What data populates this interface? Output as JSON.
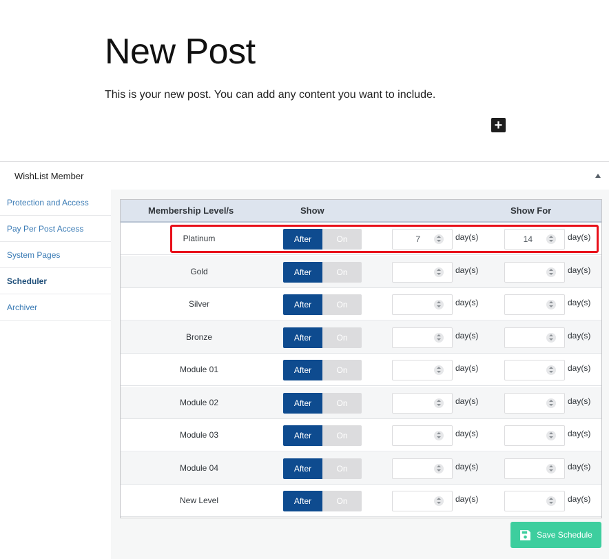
{
  "editor": {
    "title": "New Post",
    "body": "This is your new post. You can add any content you want to include.",
    "add_block_symbol": "+"
  },
  "metabox": {
    "title": "WishList Member"
  },
  "nav": [
    {
      "label": "Protection and Access",
      "active": false
    },
    {
      "label": "Pay Per Post Access",
      "active": false
    },
    {
      "label": "System Pages",
      "active": false
    },
    {
      "label": "Scheduler",
      "active": true
    },
    {
      "label": "Archiver",
      "active": false
    }
  ],
  "table": {
    "headers": {
      "level": "Membership Level/s",
      "show": "Show",
      "show_for": "Show For"
    },
    "toggle_labels": {
      "after": "After",
      "on": "On"
    },
    "unit": "day(s)",
    "rows": [
      {
        "level": "Platinum",
        "show_after": "7",
        "show_for": "14"
      },
      {
        "level": "Gold",
        "show_after": "",
        "show_for": ""
      },
      {
        "level": "Silver",
        "show_after": "",
        "show_for": ""
      },
      {
        "level": "Bronze",
        "show_after": "",
        "show_for": ""
      },
      {
        "level": "Module 01",
        "show_after": "",
        "show_for": ""
      },
      {
        "level": "Module 02",
        "show_after": "",
        "show_for": ""
      },
      {
        "level": "Module 03",
        "show_after": "",
        "show_for": ""
      },
      {
        "level": "Module 04",
        "show_after": "",
        "show_for": ""
      },
      {
        "level": "New Level",
        "show_after": "",
        "show_for": ""
      }
    ]
  },
  "save_button": {
    "label": "Save Schedule"
  },
  "colors": {
    "toggle_active": "#0e4b8f",
    "save_button": "#3dce9e",
    "highlight": "#e8101a",
    "link": "#3a7bb5"
  }
}
